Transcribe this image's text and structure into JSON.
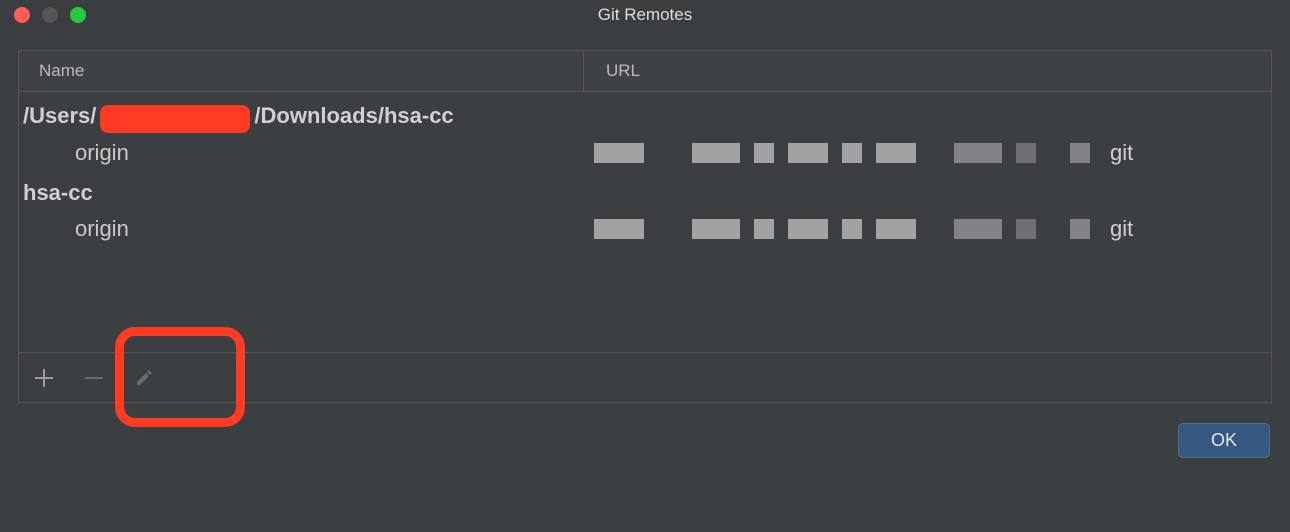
{
  "window": {
    "title": "Git Remotes"
  },
  "columns": {
    "name": "Name",
    "url": "URL"
  },
  "groups": [
    {
      "label_parts": {
        "prefix": "/Users/",
        "redacted": true,
        "suffix": "/Downloads/hsa-cc"
      },
      "remotes": [
        {
          "name": "origin",
          "url_tail": "git"
        }
      ]
    },
    {
      "label_parts": {
        "prefix": "hsa-cc",
        "redacted": false,
        "suffix": ""
      },
      "remotes": [
        {
          "name": "origin",
          "url_tail": "git"
        }
      ]
    }
  ],
  "buttons": {
    "ok": "OK"
  }
}
